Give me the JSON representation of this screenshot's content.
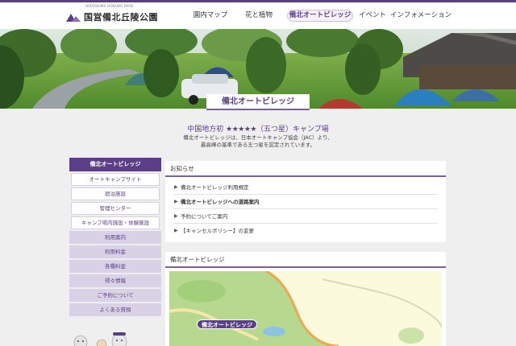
{
  "header": {
    "logo_small": "HIROSHIMA HOKUBU PARK",
    "logo_text": "国営備北丘陵公園",
    "nav": [
      {
        "label": "園内マップ"
      },
      {
        "label": "花と植物"
      },
      {
        "label": "備北オートビレッジ"
      },
      {
        "label": "イベント"
      },
      {
        "label": "インフォメーション"
      }
    ]
  },
  "hero": {
    "label": "備北オートビレッジ"
  },
  "intro": {
    "heading_pre": "中国地方初 ",
    "stars": "★★★★★",
    "heading_post": "（五つ星）キャンプ場",
    "line1": "備北オートビレッジは、日本オートキャンプ協会（JAC）より、",
    "line2": "最高峰の基準である五つ星を認定されています。"
  },
  "sidebar": {
    "heading": "備北オートビレッジ",
    "sub_items": [
      {
        "label": "オートキャンプサイト"
      },
      {
        "label": "宿泊施設"
      },
      {
        "label": "管理センター"
      },
      {
        "label": "キャンプ場内施設・体験施設"
      }
    ],
    "main_items": [
      {
        "label": "利用案内"
      },
      {
        "label": "利用料金"
      },
      {
        "label": "各種料金"
      },
      {
        "label": "得々情報"
      },
      {
        "label": "ご予約について"
      },
      {
        "label": "よくある質問"
      }
    ]
  },
  "news": {
    "title": "お知らせ",
    "items": [
      {
        "label": "備北オートビレッジ利用規定"
      },
      {
        "label": "備北オートビレッジへの道路案内"
      },
      {
        "label": "予約についてご案内"
      },
      {
        "label": "【キャンセルポリシー】の変更"
      }
    ]
  },
  "map": {
    "title": "備北オートビレッジ",
    "badge": "備北オートビレッジ"
  },
  "colors": {
    "brand": "#5b3f86",
    "sidebar_item_bg": "#d9d1e6",
    "page_bg": "#efefef"
  }
}
